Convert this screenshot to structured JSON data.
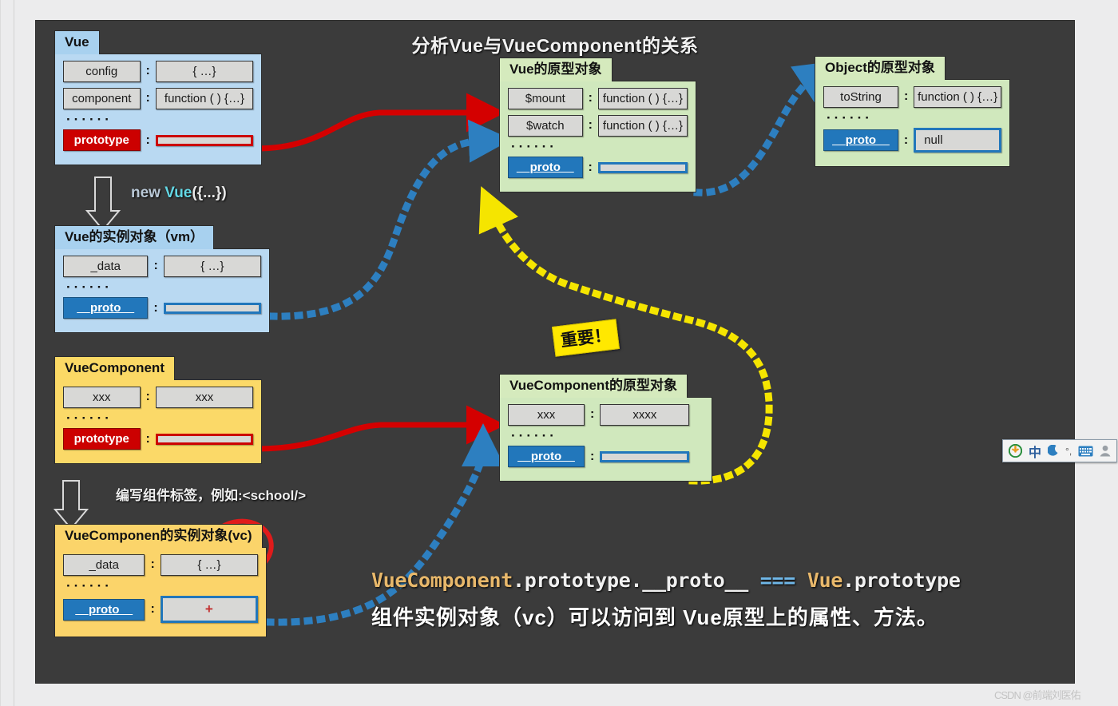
{
  "title": "分析Vue与VueComponent的关系",
  "boxes": {
    "vue": {
      "tab": "Vue",
      "rows": [
        {
          "key": "config",
          "val": "{ …}"
        },
        {
          "key": "component",
          "val": "function ( ) {…}"
        }
      ],
      "dots": "······",
      "proto": {
        "key": "prototype",
        "val": ""
      }
    },
    "vm": {
      "tab": "Vue的实例对象（vm）",
      "rows": [
        {
          "key": "_data",
          "val": "{ …}"
        }
      ],
      "dots": "······",
      "proto": {
        "key": "__proto__",
        "val": ""
      }
    },
    "vuecomponent": {
      "tab": "VueComponent",
      "rows": [
        {
          "key": "xxx",
          "val": "xxx"
        }
      ],
      "dots": "······",
      "proto": {
        "key": "prototype",
        "val": ""
      }
    },
    "vc": {
      "tab": "VueComponen的实例对象(vc)",
      "rows": [
        {
          "key": "_data",
          "val": "{ …}"
        }
      ],
      "dots": "······",
      "proto": {
        "key": "__proto__",
        "val": "",
        "marker": "+"
      }
    },
    "vue_prototype": {
      "tab": "Vue的原型对象",
      "rows": [
        {
          "key": "$mount",
          "val": "function ( ) {…}"
        },
        {
          "key": "$watch",
          "val": "function ( ) {…}"
        }
      ],
      "dots": "······",
      "proto": {
        "key": "__proto__",
        "val": ""
      }
    },
    "object_prototype": {
      "tab": "Object的原型对象",
      "rows": [
        {
          "key": "toString",
          "val": "function ( ) {…}"
        }
      ],
      "dots": "······",
      "proto": {
        "key": "__proto__",
        "val": "null"
      }
    },
    "vuecomponent_prototype": {
      "tab": "VueComponent的原型对象",
      "rows": [
        {
          "key": "xxx",
          "val": "xxxx"
        }
      ],
      "dots": "······",
      "proto": {
        "key": "__proto__",
        "val": ""
      }
    }
  },
  "flows": {
    "new_vue": {
      "word1": "new ",
      "word2": "Vue",
      "word3": "({...})"
    },
    "write_component": "编写组件标签，例如:<school/>",
    "important": "重要！"
  },
  "caption": {
    "line1_a": "VueComponent",
    "line1_b": ".prototype.__proto__ ",
    "line1_c": "=== ",
    "line1_d": "Vue",
    "line1_e": ".prototype",
    "line2": "组件实例对象（vc）可以访问到 Vue原型上的属性、方法。"
  },
  "ime": {
    "logo": "sogou-logo-icon",
    "mode": "中",
    "moon": "☽",
    "punct": "°,",
    "keyboard": "⌨",
    "user": "👤"
  },
  "watermark": "CSDN @前端刘医佑",
  "colors": {
    "canvas_bg": "#3b3b3b",
    "blue_box": "#b9d9f2",
    "green_box": "#d0e8bd",
    "yellow_box": "#fbd968",
    "red_accent": "#cc0000",
    "blue_accent": "#2277bb",
    "yellow_accent": "#ffe800"
  }
}
